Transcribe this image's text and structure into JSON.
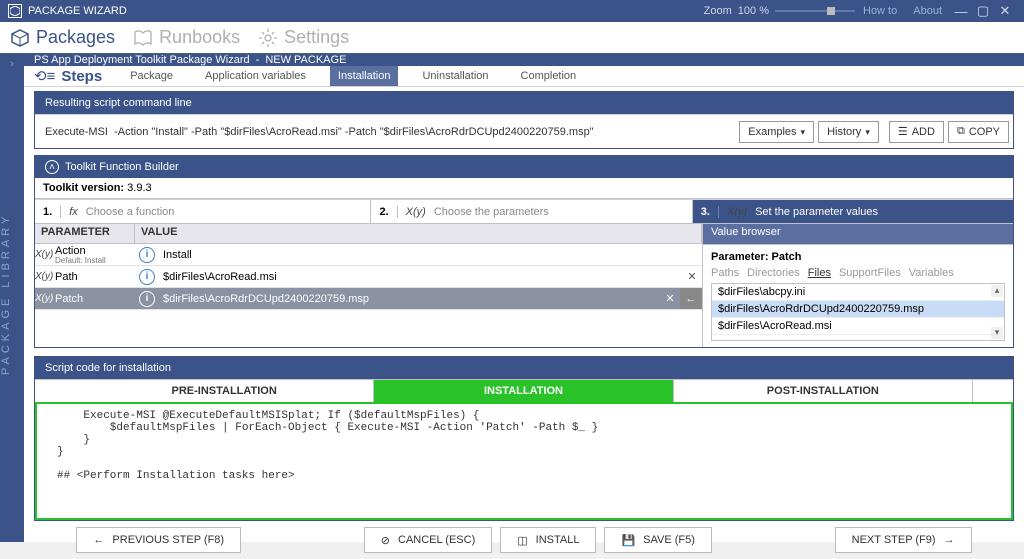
{
  "app": {
    "title": "PACKAGE WIZARD"
  },
  "zoom": {
    "label": "Zoom",
    "value": "100 %"
  },
  "topmenu": {
    "howto": "How to",
    "about": "About"
  },
  "nav": {
    "packages": "Packages",
    "runbooks": "Runbooks",
    "settings": "Settings"
  },
  "leftStrip": "PACKAGE LIBRARY",
  "wizardHeader": {
    "text": "PS App Deployment Toolkit Package Wizard",
    "sep": "-",
    "pkg": "NEW PACKAGE"
  },
  "steps": {
    "label": "Steps",
    "items": [
      "Package",
      "Application variables",
      "Installation",
      "Uninstallation",
      "Completion"
    ],
    "activeIndex": 2
  },
  "cmdPanel": {
    "header": "Resulting script command line",
    "value": "Execute-MSI  -Action \"Install\" -Path \"$dirFiles\\AcroRead.msi\" -Patch \"$dirFiles\\AcroRdrDCUpd2400220759.msp\"",
    "examples": "Examples",
    "history": "History",
    "add": "ADD",
    "copy": "COPY"
  },
  "builder": {
    "header": "Toolkit Function Builder",
    "versionLabel": "Toolkit version:",
    "version": "3.9.3",
    "step1": {
      "num": "1.",
      "fx": "fx",
      "hint": "Choose a function"
    },
    "step2": {
      "num": "2.",
      "fx": "X(y)",
      "hint": "Choose the parameters"
    },
    "step3": {
      "num": "3.",
      "fx": "X(y)",
      "hint": "Set the parameter values"
    },
    "gridHead": {
      "param": "PARAMETER",
      "value": "VALUE"
    },
    "rows": [
      {
        "prefix": "X(y)",
        "name": "Action",
        "sub": "Default: Install",
        "value": "Install",
        "clearable": false
      },
      {
        "prefix": "X(y)",
        "name": "Path",
        "sub": "",
        "value": "$dirFiles\\AcroRead.msi",
        "clearable": true
      },
      {
        "prefix": "X(y)",
        "name": "Patch",
        "sub": "",
        "value": "$dirFiles\\AcroRdrDCUpd2400220759.msp",
        "clearable": true,
        "selected": true
      }
    ]
  },
  "valueBrowser": {
    "head": "Value browser",
    "paramLabel": "Parameter:",
    "paramName": "Patch",
    "tabs": [
      "Paths",
      "Directories",
      "Files",
      "SupportFiles",
      "Variables"
    ],
    "activeTab": 2,
    "items": [
      {
        "label": "$dirFiles\\abcpy.ini"
      },
      {
        "label": "$dirFiles\\AcroRdrDCUpd2400220759.msp",
        "selected": true
      },
      {
        "label": "$dirFiles\\AcroRead.msi"
      }
    ]
  },
  "scriptPanel": {
    "header": "Script code for installation",
    "tabs": [
      "PRE-INSTALLATION",
      "INSTALLATION",
      "POST-INSTALLATION"
    ],
    "activeTab": 1,
    "code": "    Execute-MSI @ExecuteDefaultMSISplat; If ($defaultMspFiles) {\n        $defaultMspFiles | ForEach-Object { Execute-MSI -Action 'Patch' -Path $_ }\n    }\n}\n\n## <Perform Installation tasks here>"
  },
  "bottom": {
    "prev": "PREVIOUS STEP (F8)",
    "cancel": "CANCEL (ESC)",
    "install": "INSTALL",
    "save": "SAVE (F5)",
    "next": "NEXT STEP (F9)"
  }
}
